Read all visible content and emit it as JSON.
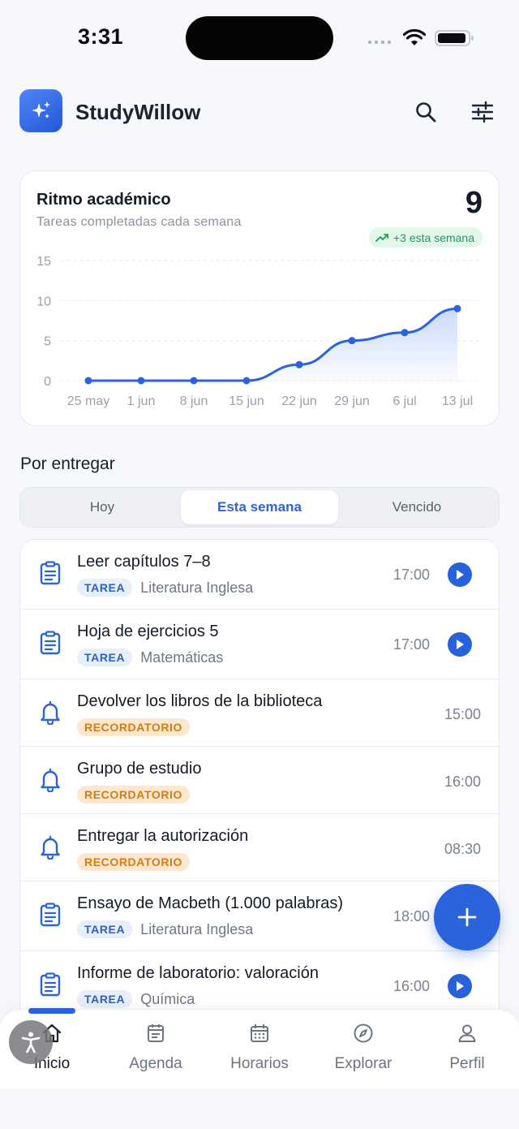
{
  "status_bar": {
    "time": "3:31"
  },
  "header": {
    "app_name": "StudyWillow",
    "logo_icon": "sparkles-icon",
    "search_icon": "search-icon",
    "filter_icon": "sliders-icon"
  },
  "chart_card": {
    "title": "Ritmo académico",
    "subtitle": "Tareas completadas cada semana",
    "current_value": "9",
    "trend_label": "+3 esta semana"
  },
  "chart_data": {
    "type": "area",
    "categories": [
      "25 may",
      "1 jun",
      "8 jun",
      "15 jun",
      "22 jun",
      "29 jun",
      "6 jul",
      "13 jul"
    ],
    "values": [
      0,
      0,
      0,
      0,
      2,
      5,
      6,
      9
    ],
    "yticks": [
      "15",
      "10",
      "5",
      "0"
    ],
    "ylim": [
      0,
      15
    ],
    "grid": true,
    "colors": {
      "line": "#2a63dc",
      "fill_top": "#c9d9fb"
    }
  },
  "section": {
    "title": "Por entregar"
  },
  "segments": [
    {
      "label": "Hoy"
    },
    {
      "label": "Esta semana"
    },
    {
      "label": "Vencido"
    }
  ],
  "items": [
    {
      "title": "Leer capítulos 7–8",
      "badge": "TAREA",
      "course": "Literatura Inglesa",
      "time": "17:00",
      "kind": "task",
      "play": true
    },
    {
      "title": "Hoja de ejercicios 5",
      "badge": "TAREA",
      "course": "Matemáticas",
      "time": "17:00",
      "kind": "task",
      "play": true
    },
    {
      "title": "Devolver los libros de la biblioteca",
      "badge": "RECORDATORIO",
      "course": "",
      "time": "15:00",
      "kind": "reminder",
      "play": false
    },
    {
      "title": "Grupo de estudio",
      "badge": "RECORDATORIO",
      "course": "",
      "time": "16:00",
      "kind": "reminder",
      "play": false
    },
    {
      "title": "Entregar la autorización",
      "badge": "RECORDATORIO",
      "course": "",
      "time": "08:30",
      "kind": "reminder",
      "play": false
    },
    {
      "title": "Ensayo de Macbeth (1.000 palabras)",
      "badge": "TAREA",
      "course": "Literatura Inglesa",
      "time": "18:00",
      "kind": "task",
      "play": false
    },
    {
      "title": "Informe de laboratorio: valoración",
      "badge": "TAREA",
      "course": "Química",
      "time": "16:00",
      "kind": "task",
      "play": true
    }
  ],
  "tabs": [
    {
      "label": "Inicio",
      "icon": "home-icon"
    },
    {
      "label": "Agenda",
      "icon": "notebook-icon"
    },
    {
      "label": "Horarios",
      "icon": "calendar-icon"
    },
    {
      "label": "Explorar",
      "icon": "compass-icon"
    },
    {
      "label": "Perfil",
      "icon": "user-icon"
    }
  ]
}
